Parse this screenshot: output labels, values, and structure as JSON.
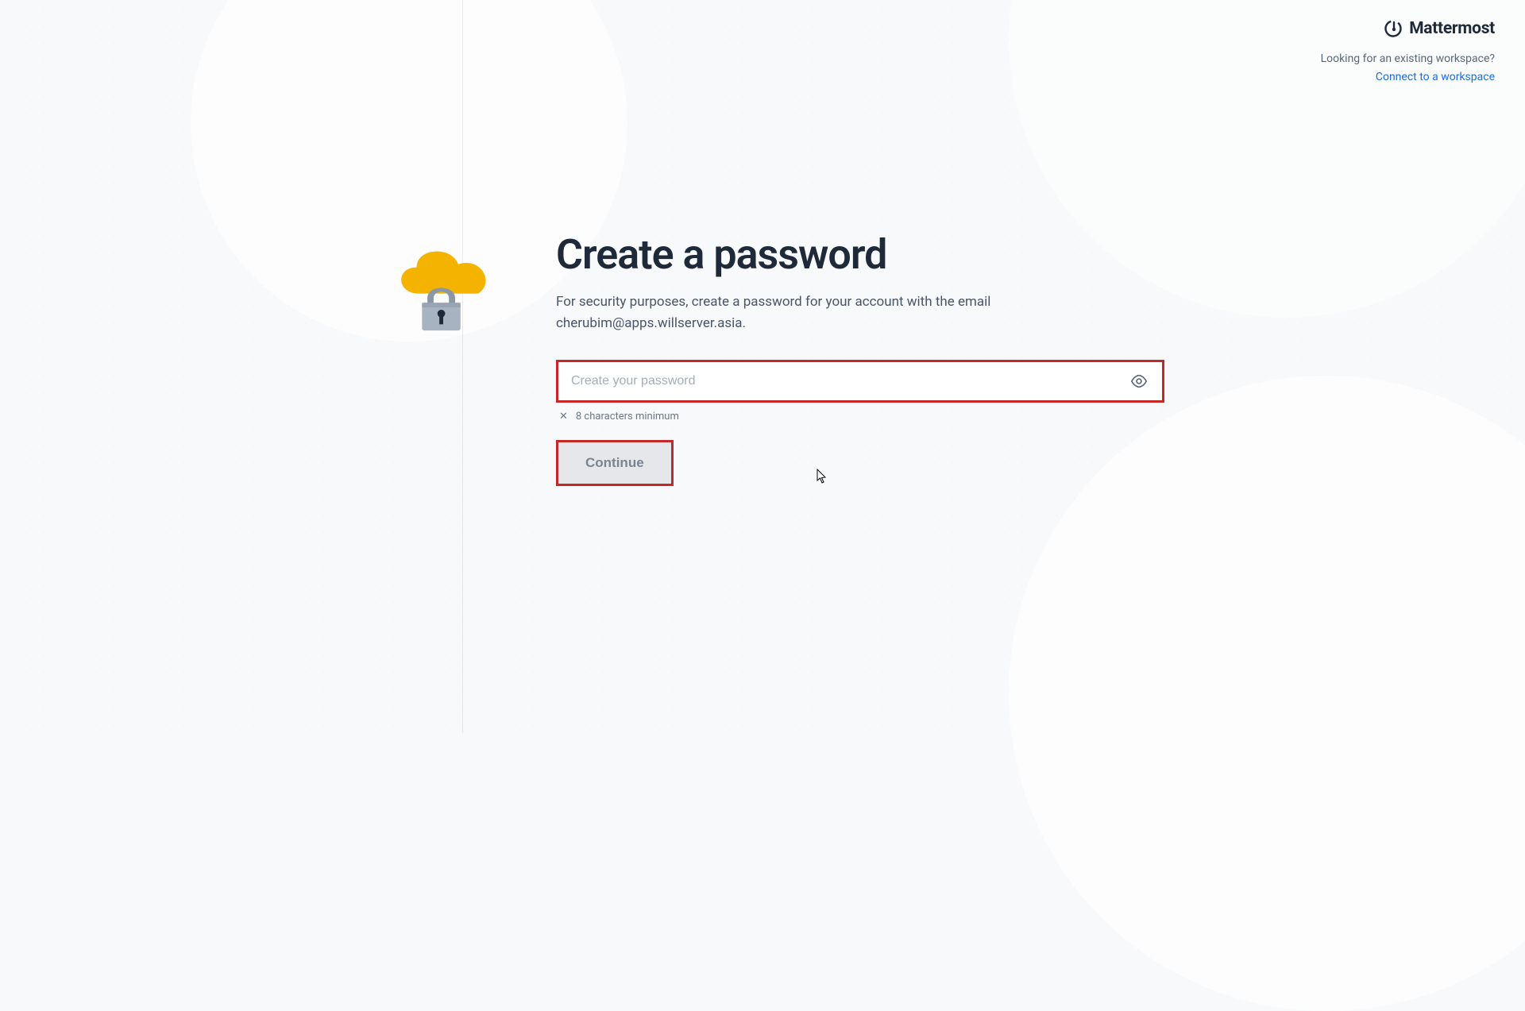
{
  "header": {
    "brand": "Mattermost",
    "question": "Looking for an existing workspace?",
    "link_text": "Connect to a workspace"
  },
  "main": {
    "heading": "Create a password",
    "subtitle": "For security purposes, create a password for your account with the email cherubim@apps.willserver.asia.",
    "password_placeholder": "Create your password",
    "requirement_text": "8 characters minimum",
    "continue_label": "Continue"
  },
  "icons": {
    "cloud_lock": "cloud-lock-icon",
    "eye": "eye-icon",
    "logo": "mattermost-logo-icon"
  },
  "highlights": {
    "input_border": "#c62828",
    "button_border": "#c62828"
  }
}
